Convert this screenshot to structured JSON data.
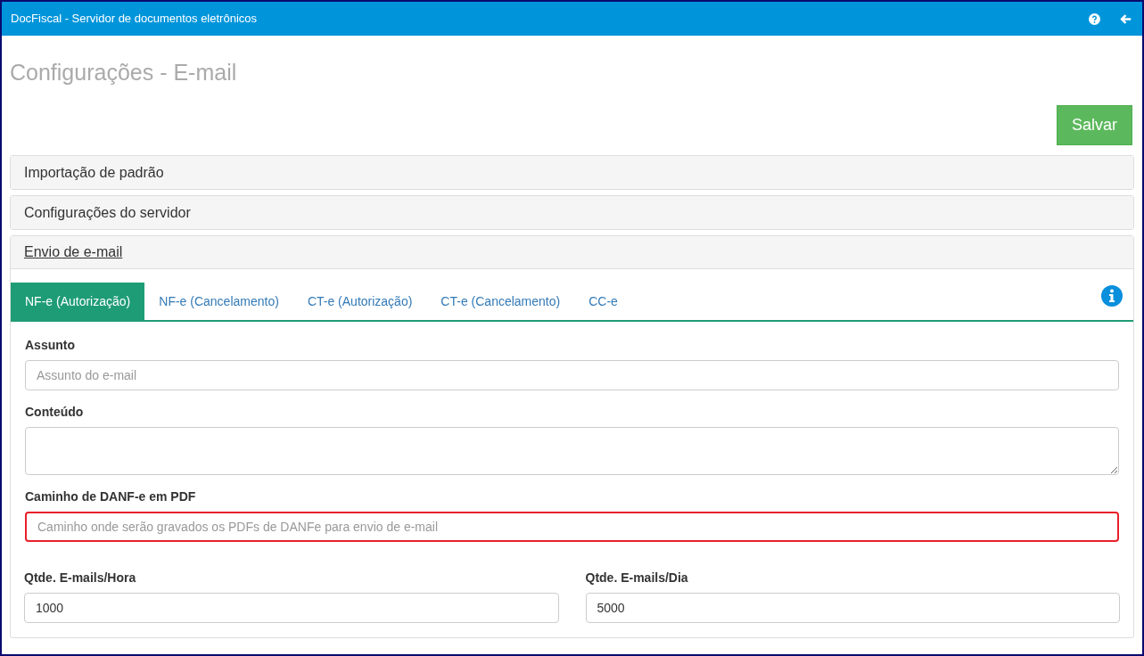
{
  "window": {
    "title": "DocFiscal - Servidor de documentos eletrônicos"
  },
  "page": {
    "title": "Configurações - E-mail",
    "save_button": "Salvar"
  },
  "sections": [
    {
      "title": "Importação de padrão",
      "expanded": false
    },
    {
      "title": "Configurações do servidor",
      "expanded": false
    },
    {
      "title": "Envio de e-mail",
      "expanded": true
    }
  ],
  "tabs": [
    {
      "label": "NF-e (Autorização)",
      "selected": true
    },
    {
      "label": "NF-e (Cancelamento)",
      "selected": false
    },
    {
      "label": "CT-e (Autorização)",
      "selected": false
    },
    {
      "label": "CT-e (Cancelamento)",
      "selected": false
    },
    {
      "label": "CC-e",
      "selected": false
    }
  ],
  "fields": [
    {
      "kind": "input",
      "label": "Assunto",
      "placeholder": "Assunto do e-mail",
      "highlighted": false
    },
    {
      "kind": "textarea",
      "label": "Conteúdo",
      "highlighted": false
    },
    {
      "kind": "input",
      "label": "Caminho de DANF-e em PDF",
      "placeholder": "Caminho onde serão gravados os PDFs de DANFe para envio de e-mail",
      "highlighted": true
    }
  ],
  "limits": [
    {
      "label": "Qtde. E-mails/Hora",
      "value": "1000"
    },
    {
      "label": "Qtde. E-mails/Dia",
      "value": "5000"
    }
  ]
}
